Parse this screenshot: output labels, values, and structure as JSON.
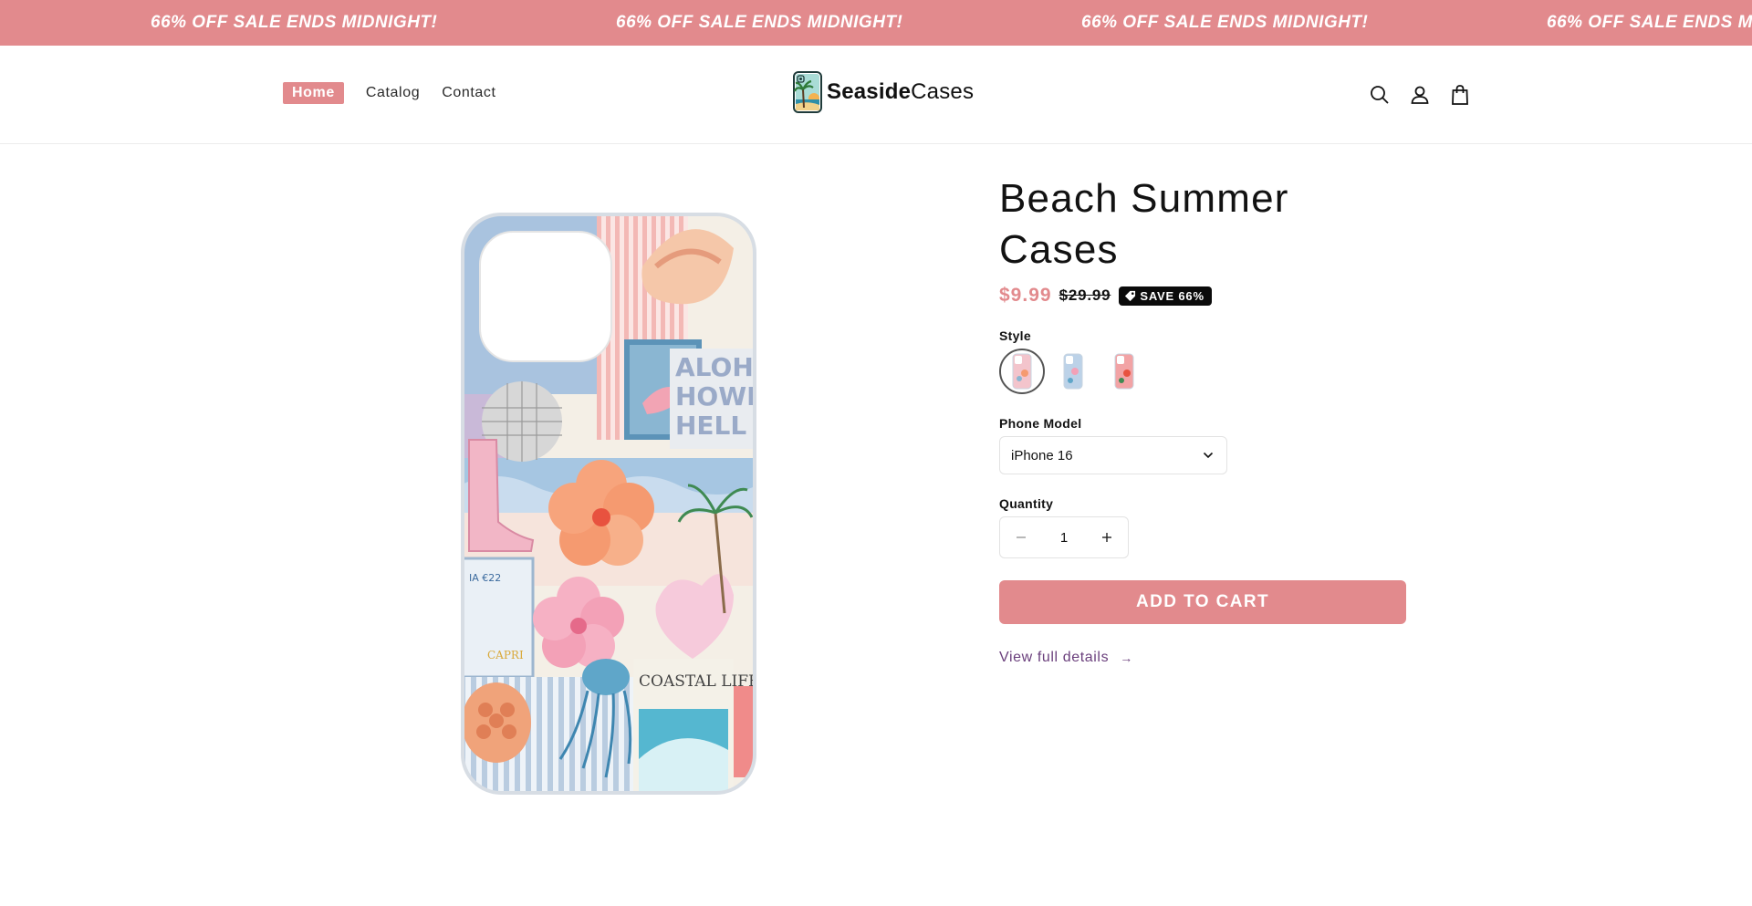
{
  "announcement": {
    "text": "66% OFF SALE ENDS MIDNIGHT!"
  },
  "nav": {
    "items": [
      {
        "label": "Home",
        "active": true
      },
      {
        "label": "Catalog"
      },
      {
        "label": "Contact"
      }
    ]
  },
  "logo": {
    "bold": "Seaside",
    "regular": "Cases"
  },
  "header_icons": [
    "search-icon",
    "account-icon",
    "cart-icon"
  ],
  "product": {
    "title": "Beach Summer Cases",
    "price": "$9.99",
    "compare_price": "$29.99",
    "badge": "SAVE 66%",
    "style_label": "Style",
    "phone_model_label": "Phone Model",
    "phone_model_value": "iPhone 16",
    "quantity_label": "Quantity",
    "quantity_value": "1",
    "add_to_cart_label": "ADD TO CART",
    "view_details_label": "View full details"
  },
  "colors": {
    "accent": "#e28a8d",
    "link": "#6a3f7c"
  }
}
